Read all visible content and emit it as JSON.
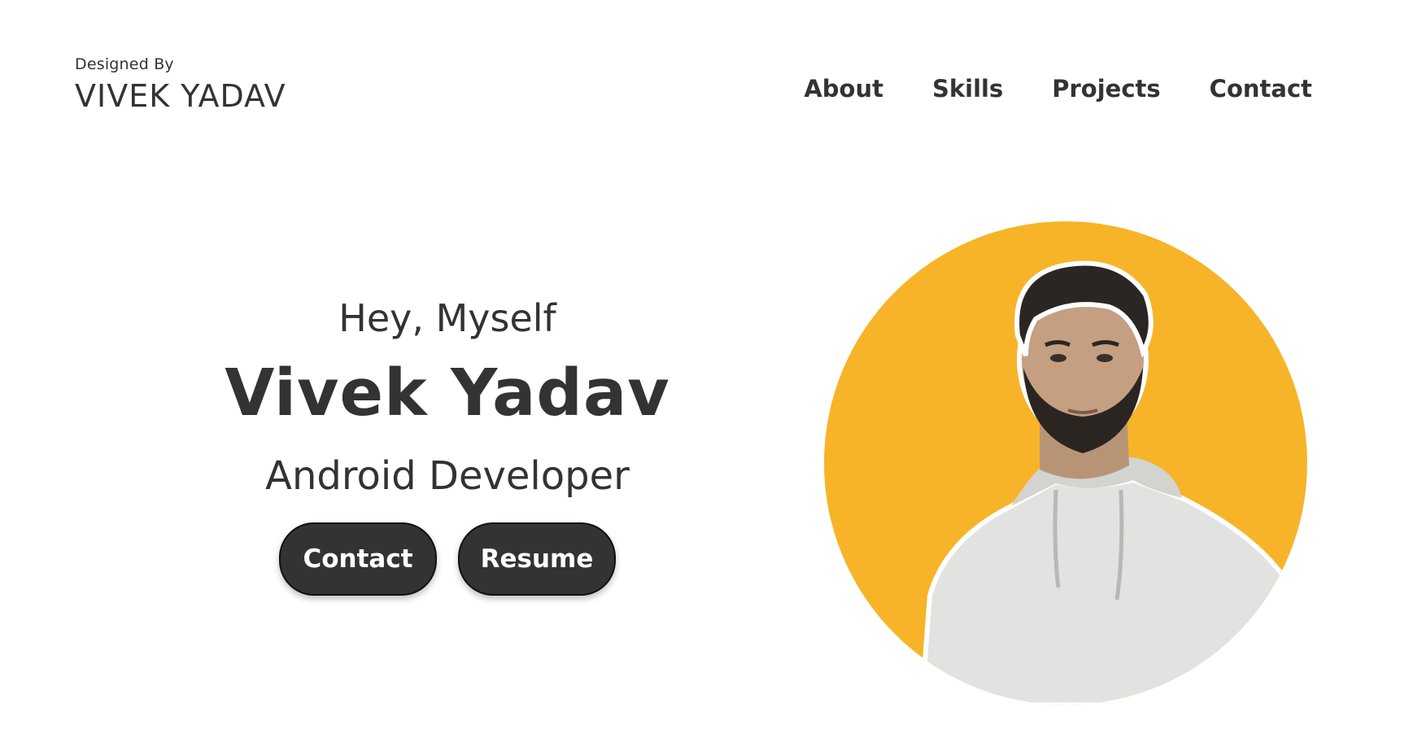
{
  "header": {
    "designed_by": "Designed By",
    "brand_name": "VIVEK YADAV",
    "nav": [
      "About",
      "Skills",
      "Projects",
      "Contact"
    ]
  },
  "hero": {
    "greeting": "Hey, Myself",
    "name": "Vivek Yadav",
    "role": "Android Developer",
    "buttons": [
      "Contact",
      "Resume"
    ]
  },
  "colors": {
    "accent_circle": "#f7b428",
    "text": "#333333",
    "button_bg": "#333333",
    "button_text": "#ffffff"
  }
}
